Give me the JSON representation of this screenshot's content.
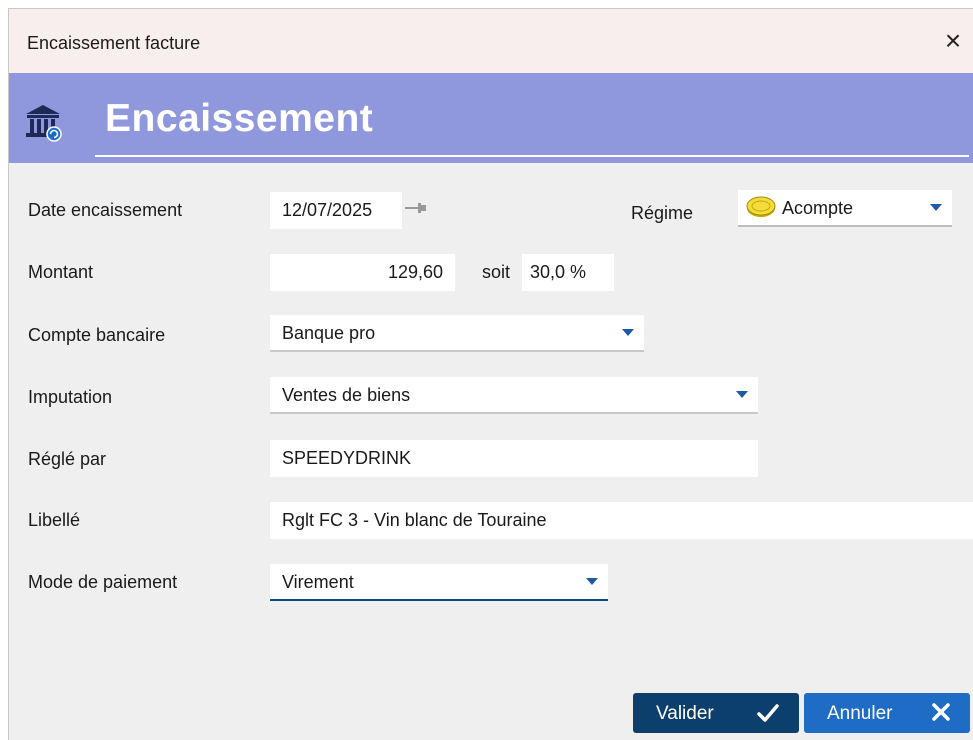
{
  "window": {
    "title": "Encaissement facture",
    "close_glyph": "×"
  },
  "header": {
    "title": "Encaissement",
    "icon": "bank-icon"
  },
  "form": {
    "date": {
      "label": "Date encaissement",
      "value": "12/07/2025"
    },
    "regime": {
      "label": "Régime",
      "value": "Acompte",
      "icon": "coin-icon"
    },
    "montant": {
      "label": "Montant",
      "value": "129,60",
      "soit_label": "soit",
      "percent": "30,0 %"
    },
    "compte": {
      "label": "Compte bancaire",
      "value": "Banque pro"
    },
    "imputation": {
      "label": "Imputation",
      "value": "Ventes de biens"
    },
    "regle_par": {
      "label": "Réglé par",
      "value": "SPEEDYDRINK"
    },
    "libelle": {
      "label": "Libellé",
      "value": "Rglt FC 3 - Vin blanc de Touraine"
    },
    "mode": {
      "label": "Mode de paiement",
      "value": "Virement"
    }
  },
  "buttons": {
    "valider": "Valider",
    "annuler": "Annuler"
  },
  "colors": {
    "banner": "#8f98dc",
    "valider": "#0d3f6c",
    "annuler": "#1f6cc6",
    "caret": "#1c5aa8"
  }
}
